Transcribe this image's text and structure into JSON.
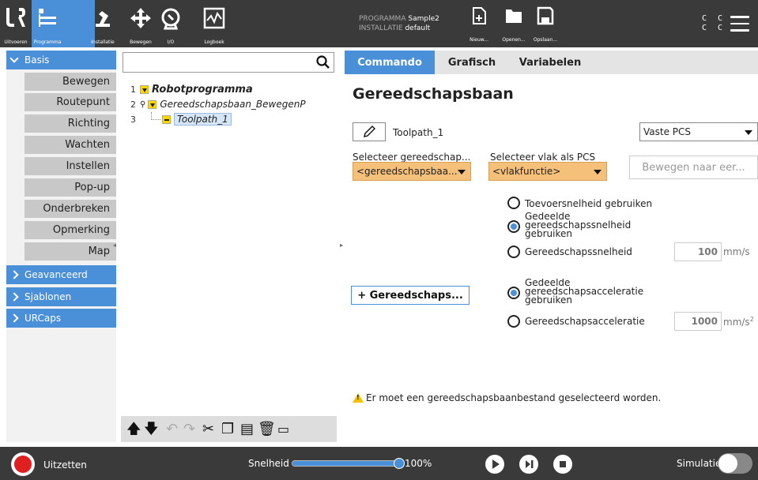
{
  "header": {
    "nav": [
      {
        "label": "Uitvoeren",
        "icon": "ur-logo-icon"
      },
      {
        "label": "Programma",
        "icon": "program-icon"
      },
      {
        "label": "Installatie",
        "icon": "robot-arm-icon"
      },
      {
        "label": "Bewegen",
        "icon": "move-arrows-icon"
      },
      {
        "label": "I/O",
        "icon": "io-icon"
      },
      {
        "label": "Logboek",
        "icon": "log-icon"
      }
    ],
    "program_label": "PROGRAMMA",
    "program_value": "Sample2",
    "installation_label": "INSTALLATIE",
    "installation_value": "default",
    "file_new": "Nieuw...",
    "file_open": "Openen...",
    "file_save": "Opslaan...",
    "cc_top": "C C",
    "cc_bottom": "C C"
  },
  "sidebar": {
    "basis": "Basis",
    "basis_items": [
      "Bewegen",
      "Routepunt",
      "Richting",
      "Wachten",
      "Instellen",
      "Pop-up",
      "Onderbreken",
      "Opmerking",
      "Map"
    ],
    "advanced": "Geavanceerd",
    "templates": "Sjablonen",
    "urcaps": "URCaps"
  },
  "tree": {
    "search_placeholder": "",
    "rows": [
      {
        "num": "1",
        "label": "Robotprogramma"
      },
      {
        "num": "2",
        "label": "Gereedschapsbaan_BewegenP"
      },
      {
        "num": "3",
        "label": "Toolpath_1"
      }
    ]
  },
  "panel": {
    "tabs": [
      "Commando",
      "Grafisch",
      "Variabelen"
    ],
    "title": "Gereedschapsbaan",
    "toolpath_name": "Toolpath_1",
    "pcs_select": "Vaste PCS",
    "select_toolpath_label": "Selecteer gereedschap...",
    "select_toolpath_value": "<gereedschapsbaa...",
    "select_plane_label": "Selecteer vlak als PCS",
    "select_plane_value": "<vlakfunctie>",
    "move_to_button": "Bewegen naar eer...",
    "opt_feed": "Toevoersnelheid gebruiken",
    "opt_shared_speed_1": "Gedeelde",
    "opt_shared_speed_2": "gereedschapssnelheid",
    "opt_shared_speed_3": "gebruiken",
    "opt_tool_speed": "Gereedschapssnelheid",
    "tool_speed_value": "100",
    "tool_speed_unit": "mm/s",
    "add_button": "+ Gereedschaps...",
    "opt_shared_acc_1": "Gedeelde",
    "opt_shared_acc_2": "gereedschapsacceleratie",
    "opt_shared_acc_3": "gebruiken",
    "opt_tool_acc": "Gereedschapsacceleratie",
    "tool_acc_value": "1000",
    "tool_acc_unit": "mm/s",
    "tool_acc_unit_sup": "2",
    "warning": "Er moet een gereedschapsbaanbestand geselecteerd worden."
  },
  "footer": {
    "power": "Uitzetten",
    "speed_label": "Snelheid",
    "speed_value": "100%",
    "speed_fraction": 1.0,
    "simulation": "Simulatie"
  },
  "colors": {
    "accent": "#4a90d9",
    "header_bg": "#3a3a3a",
    "warning_orange": "#f4c07a"
  }
}
